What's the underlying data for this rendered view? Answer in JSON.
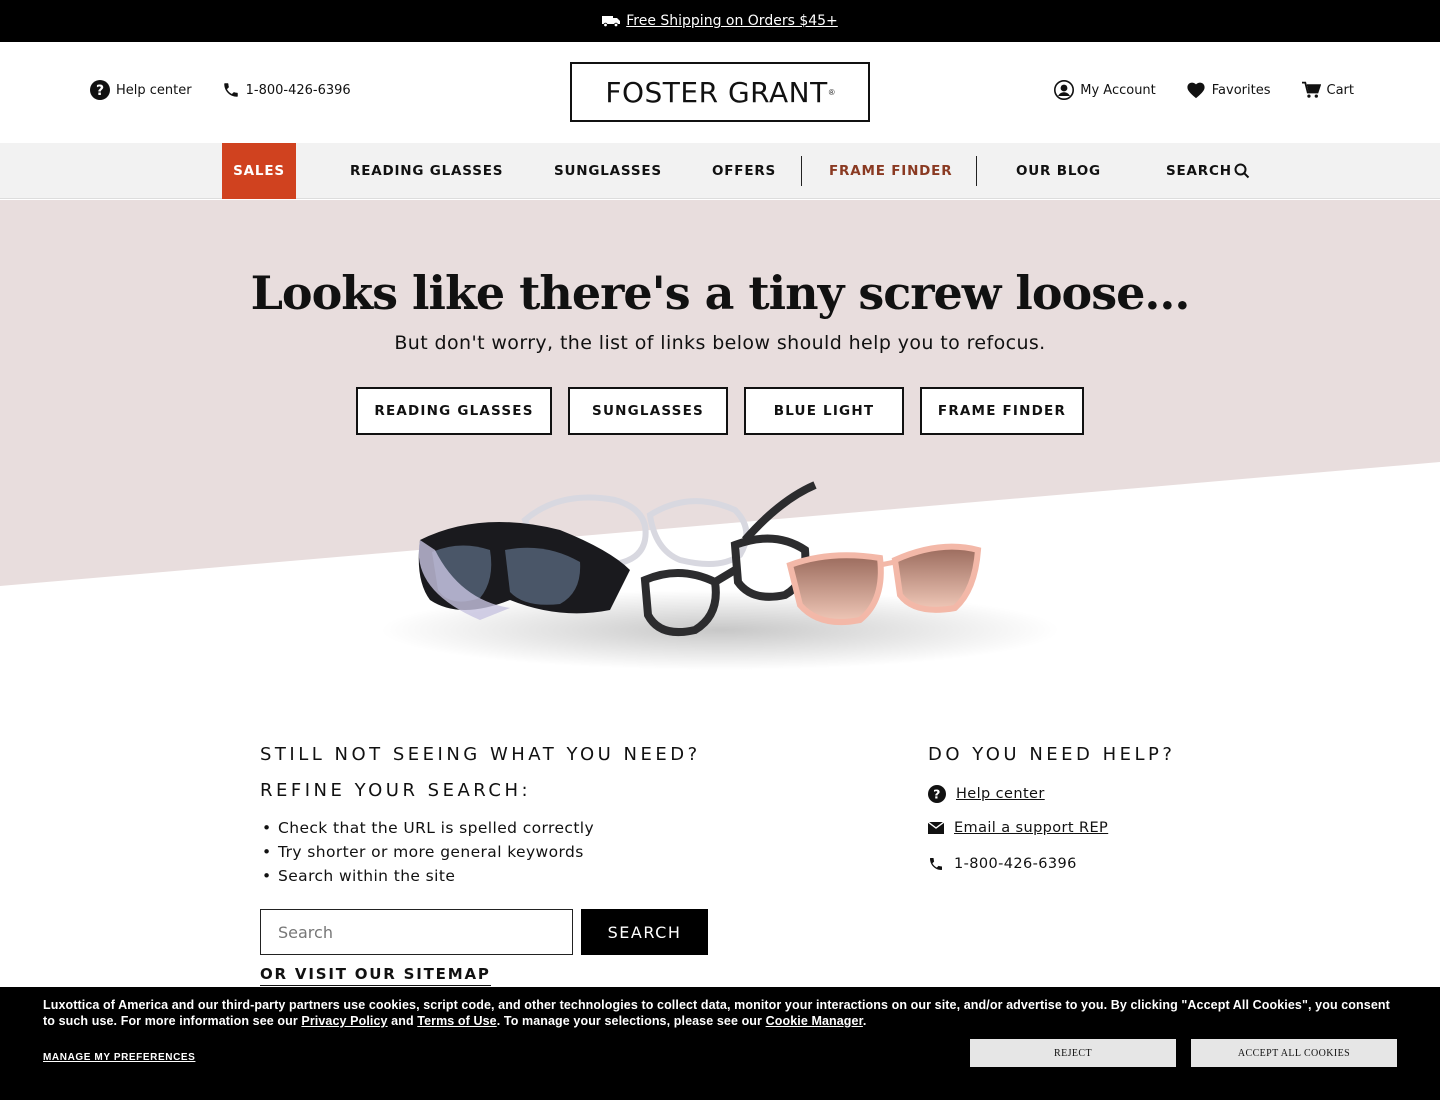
{
  "promo": {
    "text": "Free Shipping on Orders $45+",
    "icon": "truck-icon"
  },
  "header": {
    "help_center": "Help center",
    "phone": "1-800-426-6396",
    "logo": "FOSTER GRANT",
    "logo_mark": "®",
    "my_account": "My Account",
    "favorites": "Favorites",
    "cart": "Cart"
  },
  "nav": {
    "items": [
      "SALES",
      "READING GLASSES",
      "SUNGLASSES",
      "OFFERS",
      "FRAME FINDER",
      "OUR BLOG",
      "SEARCH"
    ],
    "sales_color": "#d0421f",
    "frame_finder_color": "#8a3a22"
  },
  "hero": {
    "title": "Looks like there's a tiny screw loose...",
    "subtitle": "But don't worry, the list of links below should help you to refocus.",
    "buttons": [
      "READING GLASSES",
      "SUNGLASSES",
      "BLUE LIGHT",
      "FRAME FINDER"
    ],
    "bg_color": "#e8dddd"
  },
  "refine": {
    "heading_1": "STILL NOT SEEING WHAT YOU NEED?",
    "heading_2": "REFINE YOUR SEARCH:",
    "tips": [
      "Check that the URL is spelled correctly",
      "Try shorter or more general keywords",
      "Search within the site"
    ],
    "search_placeholder": "Search",
    "search_button": "SEARCH",
    "sitemap": "OR VISIT OUR SITEMAP"
  },
  "help": {
    "heading": "DO YOU NEED HELP?",
    "help_center": "Help center",
    "email": "Email a support REP",
    "phone": "1-800-426-6396"
  },
  "cookie": {
    "text_1": "Luxottica of America and our third-party partners use cookies, script code, and other technologies to collect data, monitor your interactions on our site, and/or advertise to you. By clicking \"Accept All Cookies\", you consent to such use. For more information see our ",
    "privacy": "Privacy Policy",
    "and": " and ",
    "terms": "Terms of Use",
    "text_2": ". To manage your selections, please see our ",
    "cookie_manager": "Cookie Manager",
    "period": ".",
    "manage": "MANAGE MY PREFERENCES",
    "reject": "REJECT",
    "accept": "ACCEPT ALL COOKIES"
  }
}
